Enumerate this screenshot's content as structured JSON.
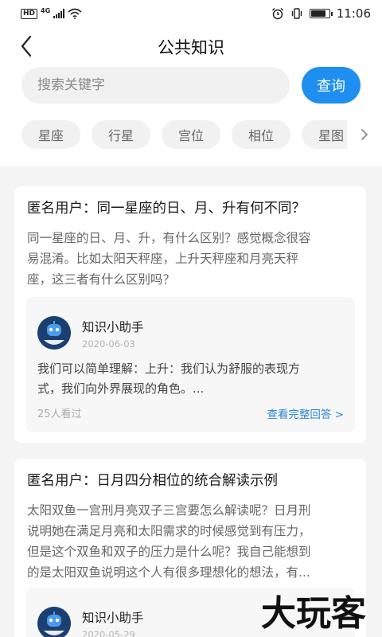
{
  "status_bar": {
    "hd": "HD",
    "network": "4G",
    "time": "11:06",
    "battery_level": 0.85
  },
  "header": {
    "title": "公共知识"
  },
  "search": {
    "placeholder": "搜索关键字",
    "button_label": "查询",
    "accent_color": "#1e8ff0"
  },
  "tags": [
    {
      "label": "星座"
    },
    {
      "label": "行星"
    },
    {
      "label": "宫位"
    },
    {
      "label": "相位"
    },
    {
      "label": "星图"
    }
  ],
  "posts": [
    {
      "title": "匿名用户：同一星座的日、月、升有何不同？",
      "body": [
        "同一星座的日、月、升，有什么区别？感觉概念很容",
        "易混淆。比如太阳天秤座，上升天秤座和月亮天秤",
        "座，这三者有什么区别吗？"
      ],
      "answer": {
        "name": "知识小助手",
        "date": "2020-06-03",
        "text": [
          "我们可以简单理解：上升：我们认为舒服的表现方",
          "式，我们向外界展现的角色。..."
        ],
        "views": "25人看过",
        "link": "查看完整回答 >"
      }
    },
    {
      "title": "匿名用户：日月四分相位的统合解读示例",
      "body": [
        "太阳双鱼一宫刑月亮双子三宫要怎么解读呢？日月刑",
        "说明她在满足月亮和太阳需求的时候感觉到有压力，",
        "但是这个双鱼和双子的压力是什么呢？我自己能想到",
        "的是太阳双鱼说明这个人有很多理想化的想法，有..."
      ],
      "answer": {
        "name": "知识小助手",
        "date": "2020-05-29"
      }
    }
  ],
  "watermark": {
    "text": "大玩客"
  }
}
